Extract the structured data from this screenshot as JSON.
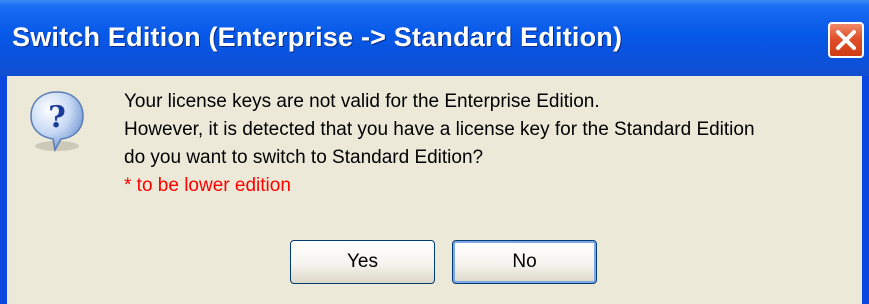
{
  "dialog": {
    "title": "Switch Edition (Enterprise -> Standard Edition)",
    "close_label": "",
    "icon": "question-icon",
    "lines": [
      "Your license keys are not valid for the Enterprise Edition.",
      "However, it is detected that you have a license key for the Standard Edition",
      "do you want to switch to Standard Edition?"
    ],
    "note": "* to be lower edition",
    "note_color": "#ff0000",
    "buttons": {
      "yes": "Yes",
      "no": "No"
    }
  },
  "colors": {
    "titlebar": "#0658e8",
    "body": "#ece9d8",
    "close": "#e0502a"
  }
}
